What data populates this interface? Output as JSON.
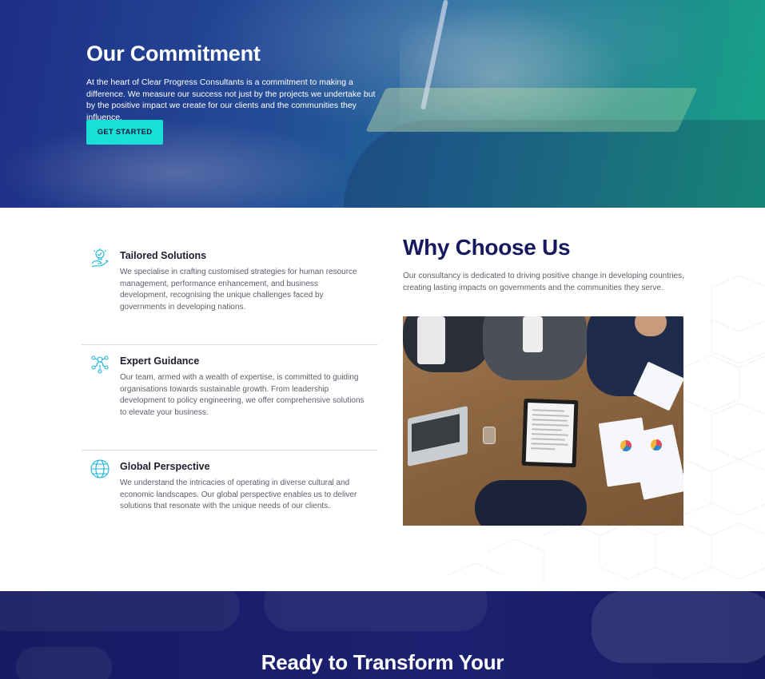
{
  "hero": {
    "title": "Our Commitment",
    "description": "At the heart of Clear Progress Consultants is a commitment to making a difference. We measure our success not just by the projects we undertake but by the positive impact we create for our clients and the communities they influence.",
    "cta_label": "GET STARTED"
  },
  "features": [
    {
      "icon": "idea-icon",
      "title": "Tailored Solutions",
      "description": "We specialise in crafting customised strategies for human resource management, performance enhancement, and business development, recognising the unique challenges faced by governments in developing nations."
    },
    {
      "icon": "network-icon",
      "title": "Expert Guidance",
      "description": "Our team, armed with a wealth of expertise, is committed to guiding organisations towards sustainable growth. From leadership development to policy engineering, we offer comprehensive solutions to elevate your business."
    },
    {
      "icon": "globe-icon",
      "title": "Global Perspective",
      "description": "We understand the intricacies of operating in diverse cultural and economic landscapes. Our global perspective enables us to deliver solutions that resonate with the unique needs of our clients."
    }
  ],
  "why": {
    "title": "Why Choose Us",
    "description": "Our consultancy is dedicated to driving positive change in developing countries, creating lasting impacts on governments and the communities they serve."
  },
  "cta": {
    "title": "Ready to Transform Your"
  },
  "colors": {
    "accent": "#19e0d6",
    "heading": "#17195e",
    "icon": "#19b6d6"
  }
}
